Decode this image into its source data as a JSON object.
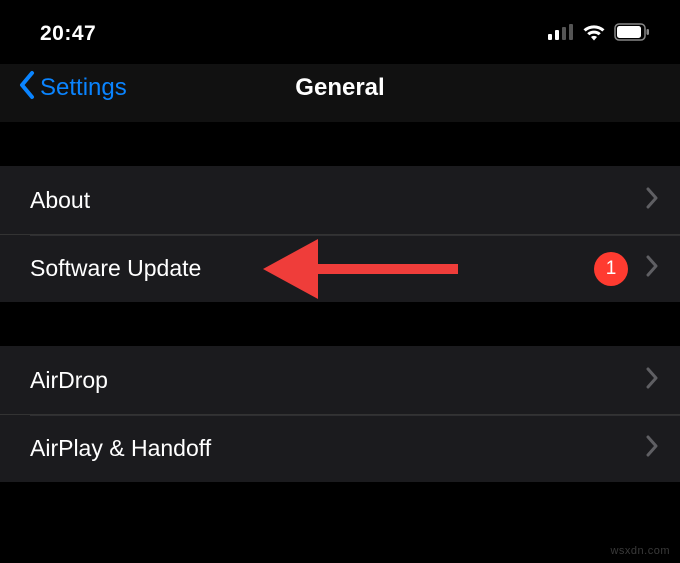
{
  "status": {
    "time": "20:47",
    "signal_bars": 4,
    "signal_active": 2,
    "wifi": true,
    "battery_pct": 85
  },
  "nav": {
    "back_label": "Settings",
    "title": "General"
  },
  "groups": [
    {
      "rows": [
        {
          "label": "About",
          "badge": null
        },
        {
          "label": "Software Update",
          "badge": "1"
        }
      ]
    },
    {
      "rows": [
        {
          "label": "AirDrop",
          "badge": null
        },
        {
          "label": "AirPlay & Handoff",
          "badge": null
        }
      ]
    }
  ],
  "watermark": "wsxdn.com",
  "colors": {
    "accent": "#0a84ff",
    "badge": "#ff3b30",
    "annotation": "#ef3d3a"
  }
}
